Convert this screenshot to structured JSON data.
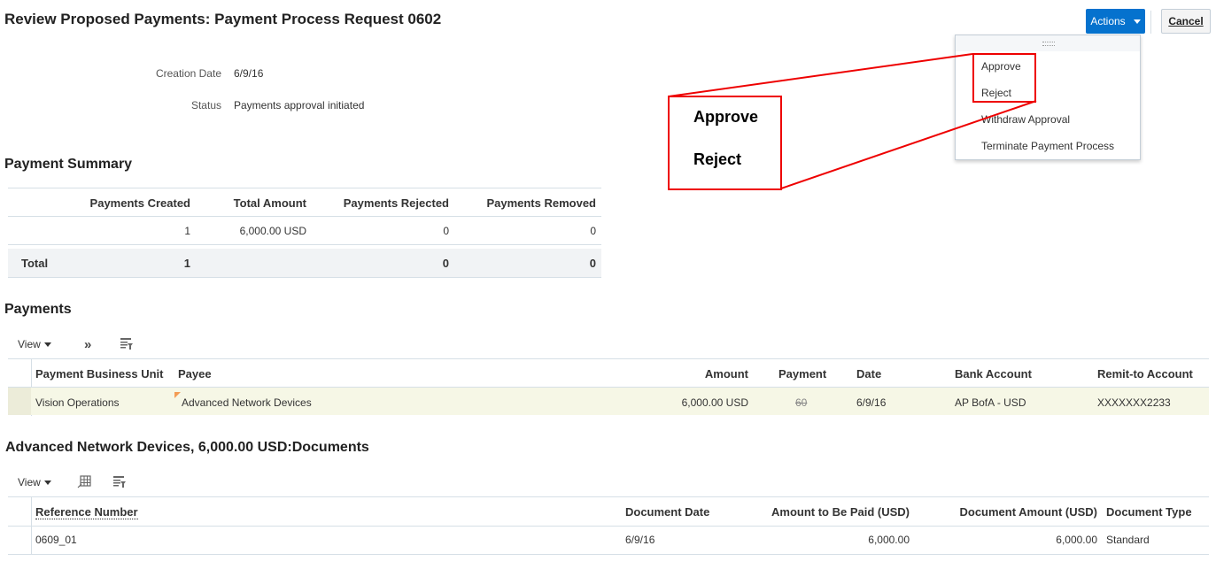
{
  "page": {
    "title": "Review Proposed Payments: Payment Process Request 0602"
  },
  "header_buttons": {
    "actions_label": "Actions",
    "cancel_label": "Cancel"
  },
  "actions_menu": {
    "items": [
      "Approve",
      "Reject",
      "Withdraw Approval",
      "Terminate Payment Process"
    ]
  },
  "callout": {
    "approve": "Approve",
    "reject": "Reject"
  },
  "info": {
    "creation_date_label": "Creation Date",
    "creation_date_value": "6/9/16",
    "status_label": "Status",
    "status_value": "Payments approval initiated"
  },
  "payment_summary": {
    "heading": "Payment Summary",
    "columns": [
      "Payments Created",
      "Total Amount",
      "Payments Rejected",
      "Payments Removed"
    ],
    "row": [
      "1",
      "6,000.00 USD",
      "0",
      "0"
    ],
    "total_label": "Total",
    "total_row": [
      "1",
      "",
      "0",
      "0"
    ]
  },
  "payments": {
    "heading": "Payments",
    "view_label": "View",
    "columns": [
      "Payment Business Unit",
      "Payee",
      "Amount",
      "Payment",
      "Date",
      "Bank Account",
      "Remit-to Account"
    ],
    "row": {
      "business_unit": "Vision Operations",
      "payee": "Advanced Network Devices",
      "amount": "6,000.00 USD",
      "payment": "60",
      "date": "6/9/16",
      "bank_account": "AP BofA - USD",
      "remit_to": "XXXXXXX2233"
    }
  },
  "documents": {
    "heading": "Advanced Network Devices, 6,000.00 USD:Documents",
    "view_label": "View",
    "columns": [
      "Reference Number",
      "Document Date",
      "Amount to Be Paid (USD)",
      "Document Amount (USD)",
      "Document Type"
    ],
    "row": {
      "reference": "0609_01",
      "date": "6/9/16",
      "amount_paid": "6,000.00",
      "doc_amount": "6,000.00",
      "type": "Standard"
    }
  },
  "colors": {
    "accent": "#0572ce",
    "highlight_row": "#f6f7e6",
    "callout_red": "#e00000"
  }
}
